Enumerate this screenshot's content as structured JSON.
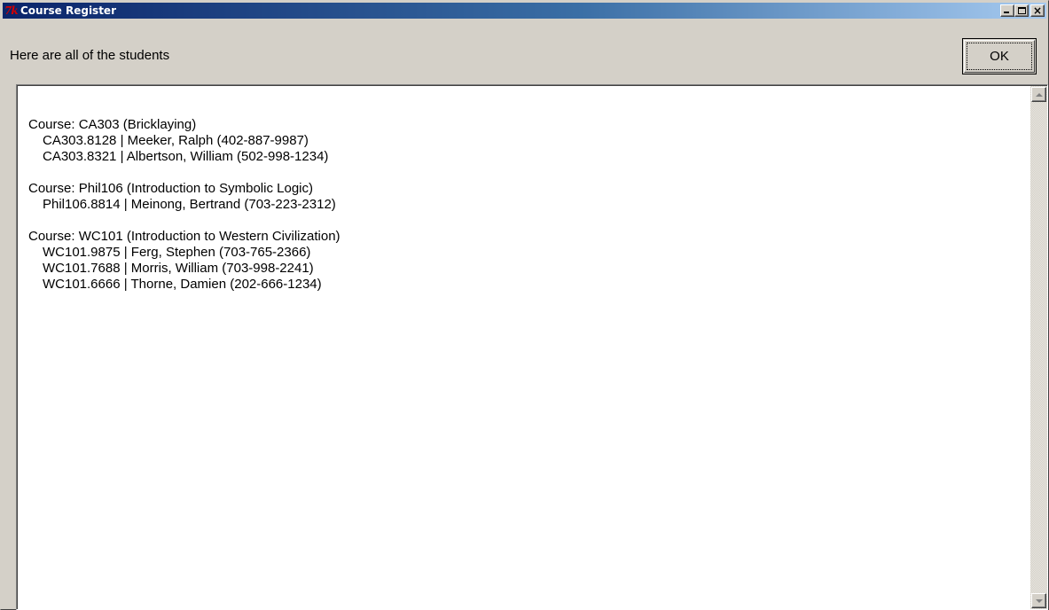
{
  "window": {
    "title": "Course Register",
    "icon": "tk-feather-icon",
    "icon_text": "7k"
  },
  "header": {
    "label": "Here are all of the students",
    "ok_label": "OK"
  },
  "courses": [
    {
      "heading": "Course: CA303 (Bricklaying)",
      "students": [
        "CA303.8128 | Meeker, Ralph (402-887-9987)",
        "CA303.8321 | Albertson, William (502-998-1234)"
      ]
    },
    {
      "heading": "Course: Phil106 (Introduction to Symbolic Logic)",
      "students": [
        "Phil106.8814 | Meinong, Bertrand (703-223-2312)"
      ]
    },
    {
      "heading": "Course: WC101 (Introduction to Western Civilization)",
      "students": [
        "WC101.9875 | Ferg, Stephen (703-765-2366)",
        "WC101.7688 | Morris, William (703-998-2241)",
        "WC101.6666 | Thorne, Damien (202-666-1234)"
      ]
    }
  ],
  "colors": {
    "titlebar_start": "#0a246a",
    "titlebar_end": "#a6caf0",
    "face": "#d4d0c8"
  }
}
